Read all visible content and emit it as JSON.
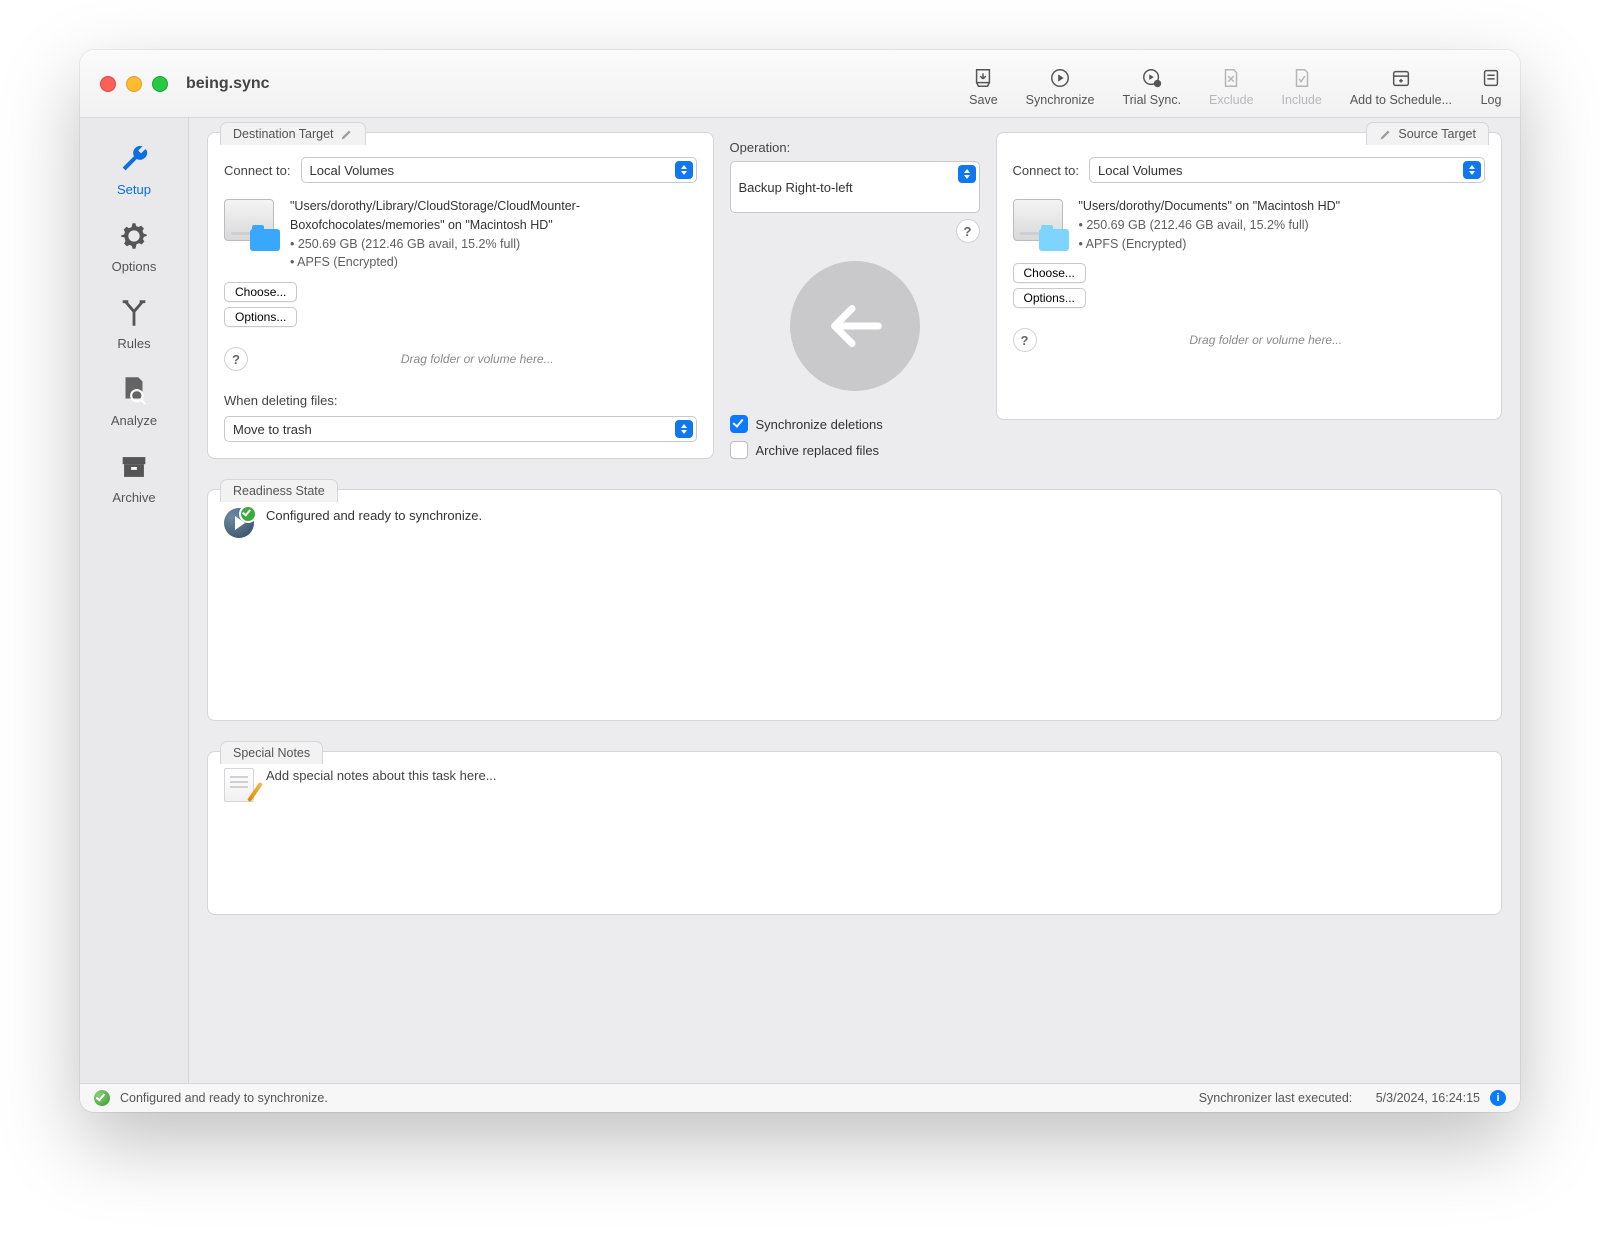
{
  "window": {
    "title": "being.sync"
  },
  "toolbar": {
    "save": "Save",
    "sync": "Synchronize",
    "trial": "Trial Sync.",
    "exclude": "Exclude",
    "include": "Include",
    "schedule": "Add to Schedule...",
    "log": "Log"
  },
  "sidebar": {
    "setup": "Setup",
    "options": "Options",
    "rules": "Rules",
    "analyze": "Analyze",
    "archive": "Archive"
  },
  "destination": {
    "tab": "Destination Target",
    "connect_label": "Connect to:",
    "connect_value": "Local Volumes",
    "path": "\"Users/dorothy/Library/CloudStorage/CloudMounter-Boxofchocolates/memories\" on \"Macintosh HD\"",
    "size": "• 250.69 GB (212.46 GB avail, 15.2% full)",
    "fs": "• APFS (Encrypted)",
    "choose": "Choose...",
    "options": "Options...",
    "drop_hint": "Drag folder or volume here...",
    "delete_label": "When deleting files:",
    "delete_value": "Move to trash"
  },
  "operation": {
    "label": "Operation:",
    "value": "Backup Right-to-left",
    "sync_deletions": "Synchronize deletions",
    "archive_replaced": "Archive replaced files"
  },
  "source": {
    "tab": "Source Target",
    "connect_label": "Connect to:",
    "connect_value": "Local Volumes",
    "path": "\"Users/dorothy/Documents\" on \"Macintosh HD\"",
    "size": "• 250.69 GB (212.46 GB avail, 15.2% full)",
    "fs": "• APFS (Encrypted)",
    "choose": "Choose...",
    "options": "Options...",
    "drop_hint": "Drag folder or volume here..."
  },
  "readiness": {
    "tab": "Readiness State",
    "message": "Configured and ready to synchronize."
  },
  "notes": {
    "tab": "Special Notes",
    "placeholder": "Add special notes about this task here..."
  },
  "status": {
    "message": "Configured and ready to synchronize.",
    "last_label": "Synchronizer last executed:",
    "last_value": "5/3/2024, 16:24:15"
  }
}
